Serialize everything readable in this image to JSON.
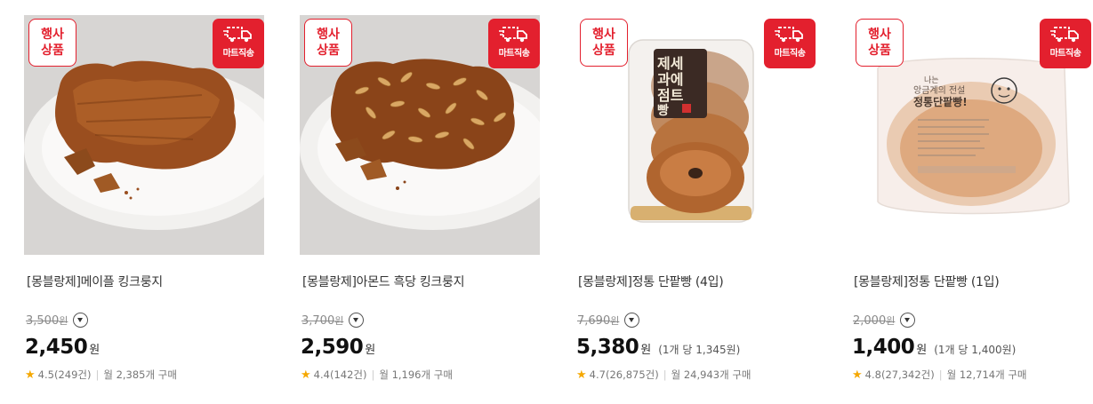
{
  "badges": {
    "event_line1": "행사",
    "event_line2": "상품",
    "mart": "마트직송"
  },
  "products": [
    {
      "name": "[몽블랑제]메이플 킹크룽지",
      "original_price": "3,500",
      "original_unit": "원",
      "price": "2,450",
      "price_unit": "원",
      "unit_price": "",
      "rating": "4.5",
      "review_count": "(249건)",
      "monthly_sales": "월 2,385개 구매"
    },
    {
      "name": "[몽블랑제]아몬드 흑당 킹크룽지",
      "original_price": "3,700",
      "original_unit": "원",
      "price": "2,590",
      "price_unit": "원",
      "unit_price": "",
      "rating": "4.4",
      "review_count": "(142건)",
      "monthly_sales": "월 1,196개 구매"
    },
    {
      "name": "[몽블랑제]정통 단팥빵 (4입)",
      "original_price": "7,690",
      "original_unit": "원",
      "price": "5,380",
      "price_unit": "원",
      "unit_price": "(1개 당 1,345원)",
      "rating": "4.7",
      "review_count": "(26,875건)",
      "monthly_sales": "월 24,943개 구매",
      "package_text": [
        "제세",
        "과에",
        "점트",
        "빵"
      ]
    },
    {
      "name": "[몽블랑제]정통 단팥빵 (1입)",
      "original_price": "2,000",
      "original_unit": "원",
      "price": "1,400",
      "price_unit": "원",
      "unit_price": "(1개 당 1,400원)",
      "rating": "4.8",
      "review_count": "(27,342건)",
      "monthly_sales": "월 12,714개 구매",
      "package_text": [
        "나는",
        "앙금계의 전설",
        "정통단팥빵!"
      ]
    }
  ],
  "colors": {
    "accent_red": "#e3202e",
    "star": "#f5a800"
  }
}
